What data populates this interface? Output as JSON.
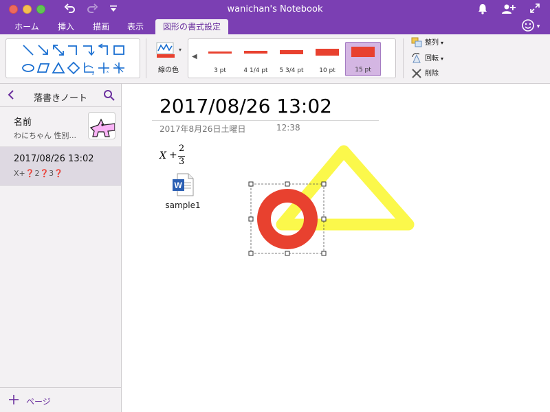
{
  "window": {
    "title": "wanichan's Notebook"
  },
  "tabs": [
    {
      "label": "ホーム"
    },
    {
      "label": "挿入"
    },
    {
      "label": "描画"
    },
    {
      "label": "表示"
    },
    {
      "label": "図形の書式設定"
    }
  ],
  "ribbon": {
    "line_color_label": "線の色",
    "line_color": "#e8412f",
    "weights": [
      {
        "label": "3 pt"
      },
      {
        "label": "4 1/4 pt"
      },
      {
        "label": "5 3/4 pt"
      },
      {
        "label": "10 pt"
      },
      {
        "label": "15 pt"
      }
    ],
    "selected_weight": "15 pt",
    "arrange_label": "整列",
    "rotate_label": "回転",
    "delete_label": "削除"
  },
  "sidebar": {
    "title": "落書きノート",
    "pages": [
      {
        "title": "名前",
        "subtitle": "わにちゃん 性別..."
      },
      {
        "title": "2017/08/26 13:02",
        "subtitle": "X+❓2❓3❓"
      }
    ],
    "add_page_label": "ページ"
  },
  "note": {
    "title": "2017/08/26 13:02",
    "date": "2017年8月26日土曜日",
    "time": "12:38",
    "math": {
      "x": "X",
      "plus": "+",
      "numerator": "2",
      "denominator": "3"
    },
    "attachment_name": "sample1"
  },
  "colors": {
    "brand": "#7b3fb3",
    "circle": "#e8412f",
    "triangle": "#fbf84b"
  }
}
